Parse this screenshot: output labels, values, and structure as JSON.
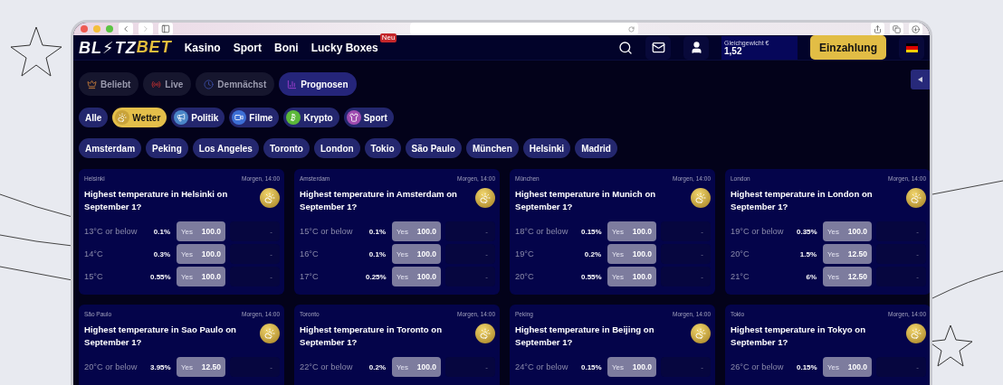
{
  "logo": {
    "main": "BL⚡TZ",
    "accent": "BET"
  },
  "nav": [
    {
      "label": "Kasino"
    },
    {
      "label": "Sport"
    },
    {
      "label": "Boni"
    },
    {
      "label": "Lucky Boxes",
      "badge": "Neu"
    }
  ],
  "balance": {
    "label": "Gleichgewicht €",
    "value": "1,52"
  },
  "deposit_button": "Einzahlung",
  "tabs": [
    {
      "label": "Beliebt",
      "selected": false
    },
    {
      "label": "Live",
      "selected": false
    },
    {
      "label": "Demnächst",
      "selected": false
    },
    {
      "label": "Prognosen",
      "selected": true
    }
  ],
  "categories": [
    {
      "label": "Alle",
      "selected": false
    },
    {
      "label": "Wetter",
      "color": "#c9a33a",
      "selected": true
    },
    {
      "label": "Politik",
      "color": "#4a86c8",
      "selected": false
    },
    {
      "label": "Filme",
      "color": "#3d6fd6",
      "selected": false
    },
    {
      "label": "Krypto",
      "color": "#5cb83a",
      "selected": false
    },
    {
      "label": "Sport",
      "color": "#a04cb0",
      "selected": false
    }
  ],
  "cities": [
    {
      "label": "Amsterdam",
      "selected": false
    },
    {
      "label": "Peking",
      "selected": false
    },
    {
      "label": "Los Angeles",
      "selected": false
    },
    {
      "label": "Toronto",
      "selected": false
    },
    {
      "label": "London",
      "selected": false
    },
    {
      "label": "Tokio",
      "selected": false
    },
    {
      "label": "São Paulo",
      "selected": false
    },
    {
      "label": "München",
      "selected": false
    },
    {
      "label": "Helsinki",
      "selected": false
    },
    {
      "label": "Madrid",
      "selected": false
    }
  ],
  "markets": [
    {
      "city": "Helsinki",
      "time": "Morgen, 14:00",
      "question": "Highest temperature in Helsinki on September 1?",
      "options": [
        {
          "label": "13°C or below",
          "chance": "0.1%",
          "side": "Yes",
          "price": "100.0",
          "no": "-"
        },
        {
          "label": "14°C",
          "chance": "0.3%",
          "side": "Yes",
          "price": "100.0",
          "no": "-"
        },
        {
          "label": "15°C",
          "chance": "0.55%",
          "side": "Yes",
          "price": "100.0",
          "no": "-"
        }
      ]
    },
    {
      "city": "Amsterdam",
      "time": "Morgen, 14:00",
      "question": "Highest temperature in Amsterdam on September 1?",
      "options": [
        {
          "label": "15°C or below",
          "chance": "0.1%",
          "side": "Yes",
          "price": "100.0",
          "no": "-"
        },
        {
          "label": "16°C",
          "chance": "0.1%",
          "side": "Yes",
          "price": "100.0",
          "no": "-"
        },
        {
          "label": "17°C",
          "chance": "0.25%",
          "side": "Yes",
          "price": "100.0",
          "no": "-"
        }
      ]
    },
    {
      "city": "München",
      "time": "Morgen, 14:00",
      "question": "Highest temperature in Munich on September 1?",
      "options": [
        {
          "label": "18°C or below",
          "chance": "0.15%",
          "side": "Yes",
          "price": "100.0",
          "no": "-"
        },
        {
          "label": "19°C",
          "chance": "0.2%",
          "side": "Yes",
          "price": "100.0",
          "no": "-"
        },
        {
          "label": "20°C",
          "chance": "0.55%",
          "side": "Yes",
          "price": "100.0",
          "no": "-"
        }
      ]
    },
    {
      "city": "London",
      "time": "Morgen, 14:00",
      "question": "Highest temperature in London on September 1?",
      "options": [
        {
          "label": "19°C or below",
          "chance": "0.35%",
          "side": "Yes",
          "price": "100.0",
          "no": "-"
        },
        {
          "label": "20°C",
          "chance": "1.5%",
          "side": "Yes",
          "price": "12.50",
          "no": "-"
        },
        {
          "label": "21°C",
          "chance": "6%",
          "side": "Yes",
          "price": "12.50",
          "no": "-"
        }
      ]
    },
    {
      "city": "São Paulo",
      "time": "Morgen, 14:00",
      "question": "Highest temperature in Sao Paulo on September 1?",
      "options": [
        {
          "label": "20°C or below",
          "chance": "3.95%",
          "side": "Yes",
          "price": "12.50",
          "no": "-"
        }
      ]
    },
    {
      "city": "Toronto",
      "time": "Morgen, 14:00",
      "question": "Highest temperature in Toronto on September 1?",
      "options": [
        {
          "label": "22°C or below",
          "chance": "0.2%",
          "side": "Yes",
          "price": "100.0",
          "no": "-"
        }
      ]
    },
    {
      "city": "Peking",
      "time": "Morgen, 14:00",
      "question": "Highest temperature in Beijing on September 1?",
      "options": [
        {
          "label": "24°C or below",
          "chance": "0.15%",
          "side": "Yes",
          "price": "100.0",
          "no": "-"
        }
      ]
    },
    {
      "city": "Tokio",
      "time": "Morgen, 14:00",
      "question": "Highest temperature in Tokyo on September 1?",
      "options": [
        {
          "label": "26°C or below",
          "chance": "0.15%",
          "side": "Yes",
          "price": "100.0",
          "no": "-"
        }
      ]
    }
  ]
}
